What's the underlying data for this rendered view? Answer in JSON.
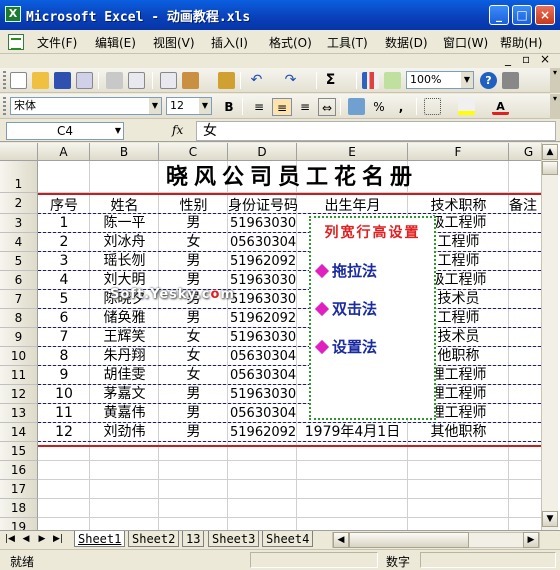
{
  "window": {
    "title": "Microsoft Excel - 动画教程.xls",
    "minimize": "_",
    "maximize": "□",
    "close": "×"
  },
  "menu": {
    "items": [
      "文件(F)",
      "编辑(E)",
      "视图(V)",
      "插入(I)",
      "格式(O)",
      "工具(T)",
      "数据(D)",
      "窗口(W)",
      "帮助(H)"
    ],
    "doc_min": "_",
    "doc_restore": "▫",
    "doc_close": "×"
  },
  "toolbar": {
    "zoom": "100%",
    "font_name": "宋体",
    "font_size": "12",
    "bold": "B",
    "sigma": "Σ",
    "percent": "%",
    "comma": ","
  },
  "formula_bar": {
    "cell_ref": "C4",
    "fx": "fx",
    "content": "女"
  },
  "sheet": {
    "columns": [
      "A",
      "B",
      "C",
      "D",
      "E",
      "F",
      "G"
    ],
    "rows": [
      "1",
      "2",
      "3",
      "4",
      "5",
      "6",
      "7",
      "8",
      "9",
      "10",
      "11",
      "12",
      "13",
      "14",
      "15",
      "16",
      "17",
      "18",
      "19"
    ],
    "title": "晓风公司员工花名册",
    "headers": [
      "序号",
      "姓名",
      "性别",
      "身份证号码",
      "出生年月",
      "技术职称",
      "备注"
    ],
    "records": [
      [
        "1",
        "陈一平",
        "男",
        "51963030",
        "",
        "级工程师"
      ],
      [
        "2",
        "刘冰舟",
        "女",
        "05630304",
        "",
        "工程师"
      ],
      [
        "3",
        "瑶长刎",
        "男",
        "51962092",
        "",
        "工程师"
      ],
      [
        "4",
        "刘大明",
        "男",
        "51963030",
        "",
        "级工程师"
      ],
      [
        "5",
        "陈晓夕",
        "男",
        "51963030",
        "",
        "技术员"
      ],
      [
        "6",
        "储奂雅",
        "男",
        "51962092",
        "",
        "工程师"
      ],
      [
        "7",
        "王辉笑",
        "女",
        "51963030",
        "",
        "技术员"
      ],
      [
        "8",
        "朱丹翔",
        "女",
        "05630304",
        "",
        "他职称"
      ],
      [
        "9",
        "胡佳雯",
        "女",
        "05630304",
        "",
        "理工程师"
      ],
      [
        "10",
        "茅嘉文",
        "男",
        "51963030",
        "",
        "理工程师"
      ],
      [
        "11",
        "黄嘉伟",
        "男",
        "05630304",
        "",
        "理工程师"
      ],
      [
        "12",
        "刘劲伟",
        "男",
        "51962092",
        "1979年4月1日",
        "其他职称"
      ]
    ]
  },
  "popup": {
    "title": "列宽行高设置",
    "items": [
      "拖拉法",
      "双击法",
      "设置法"
    ]
  },
  "watermark": {
    "text_before": "Soft.Yesky.c",
    "text_accent": "o",
    "text_after": "m"
  },
  "tabs": [
    "Sheet1",
    "Sheet2",
    "13",
    "Sheet3",
    "Sheet4"
  ],
  "status": {
    "ready": "就绪",
    "numlock": "数字"
  },
  "colors": {
    "title_bar": "#0a4fd0",
    "popup_title": "#e02020",
    "popup_items": "#1a2aa0",
    "popup_border": "#2a9a2a",
    "diamond": "#e020c0",
    "table_border_red": "#c02020"
  }
}
